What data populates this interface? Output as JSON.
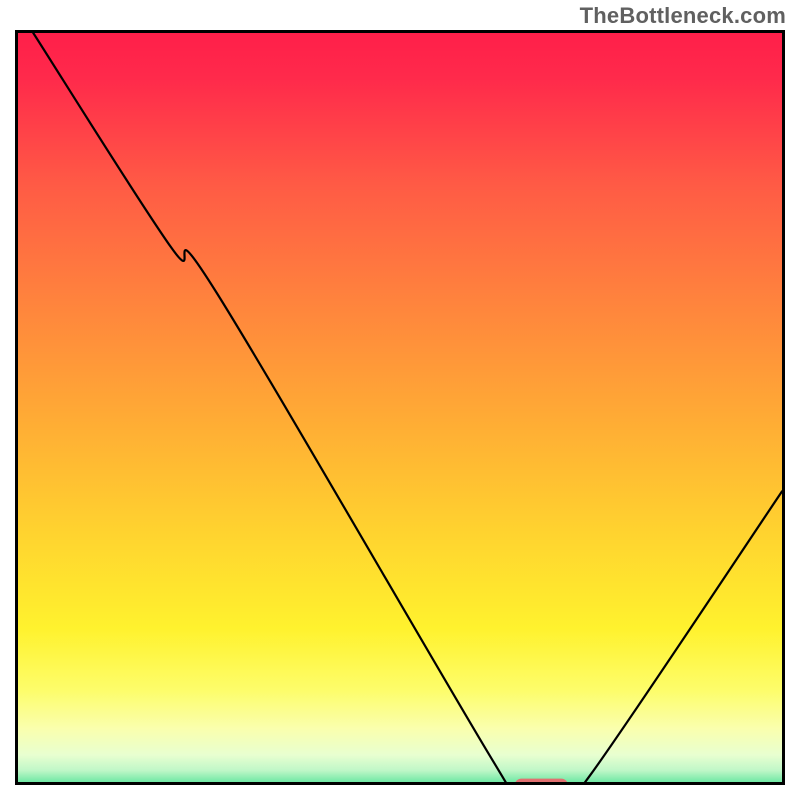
{
  "watermark": "TheBottleneck.com",
  "chart_data": {
    "type": "line",
    "title": "",
    "xlabel": "",
    "ylabel": "",
    "xlim": [
      0,
      100
    ],
    "ylim": [
      0,
      100
    ],
    "series": [
      {
        "name": "bottleneck-curve",
        "x": [
          2,
          20,
          26,
          62,
          65,
          72,
          75,
          100
        ],
        "values": [
          100,
          72,
          66,
          5,
          1.5,
          1.5,
          3,
          40
        ]
      }
    ],
    "marker": {
      "name": "optimal-range",
      "x_center": 68.5,
      "y": 1.5,
      "width": 7,
      "color_hex": "#e27070"
    },
    "background_gradient": {
      "stops": [
        {
          "offset": 0.0,
          "color": "#ff1f4a"
        },
        {
          "offset": 0.06,
          "color": "#ff2a4b"
        },
        {
          "offset": 0.2,
          "color": "#ff5b45"
        },
        {
          "offset": 0.35,
          "color": "#ff833d"
        },
        {
          "offset": 0.5,
          "color": "#ffaa35"
        },
        {
          "offset": 0.65,
          "color": "#ffd22f"
        },
        {
          "offset": 0.78,
          "color": "#fff22e"
        },
        {
          "offset": 0.86,
          "color": "#fdfd6a"
        },
        {
          "offset": 0.91,
          "color": "#faffad"
        },
        {
          "offset": 0.945,
          "color": "#e8ffd0"
        },
        {
          "offset": 0.965,
          "color": "#c0f7c8"
        },
        {
          "offset": 0.98,
          "color": "#72e8a5"
        },
        {
          "offset": 0.992,
          "color": "#2ed884"
        },
        {
          "offset": 1.0,
          "color": "#1bcf78"
        }
      ]
    },
    "curve_stroke_hex": "#000000",
    "frame_stroke_hex": "#000000"
  }
}
